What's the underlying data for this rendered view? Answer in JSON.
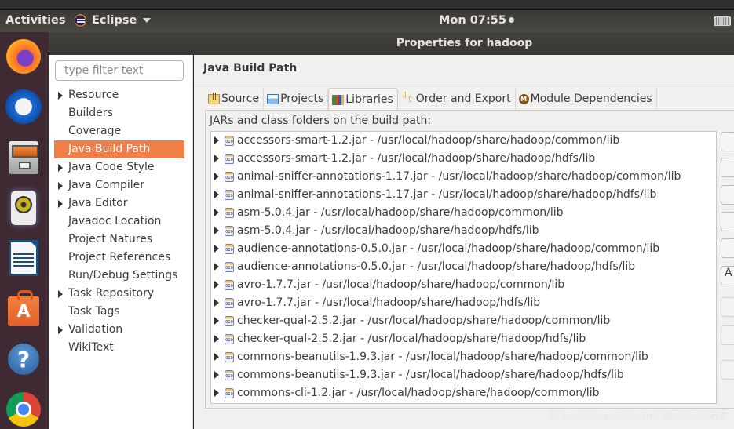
{
  "topbar": {
    "activities": "Activities",
    "app_name": "Eclipse",
    "clock": "Mon 07:55"
  },
  "dock": {
    "items": [
      {
        "name": "firefox-icon"
      },
      {
        "name": "thunderbird-icon"
      },
      {
        "name": "files-icon"
      },
      {
        "name": "rhythmbox-icon"
      },
      {
        "name": "libreoffice-writer-icon"
      },
      {
        "name": "ubuntu-software-icon"
      },
      {
        "name": "help-icon"
      },
      {
        "name": "chrome-icon"
      }
    ]
  },
  "dialog": {
    "title": "Properties for hadoop"
  },
  "nav": {
    "filter_placeholder": "type filter text",
    "items": [
      {
        "label": "Resource",
        "expandable": true
      },
      {
        "label": "Builders",
        "expandable": false
      },
      {
        "label": "Coverage",
        "expandable": false
      },
      {
        "label": "Java Build Path",
        "expandable": false,
        "selected": true
      },
      {
        "label": "Java Code Style",
        "expandable": true
      },
      {
        "label": "Java Compiler",
        "expandable": true
      },
      {
        "label": "Java Editor",
        "expandable": true
      },
      {
        "label": "Javadoc Location",
        "expandable": false
      },
      {
        "label": "Project Natures",
        "expandable": false
      },
      {
        "label": "Project References",
        "expandable": false
      },
      {
        "label": "Run/Debug Settings",
        "expandable": false
      },
      {
        "label": "Task Repository",
        "expandable": true
      },
      {
        "label": "Task Tags",
        "expandable": false
      },
      {
        "label": "Validation",
        "expandable": true
      },
      {
        "label": "WikiText",
        "expandable": false
      }
    ]
  },
  "page": {
    "title": "Java Build Path",
    "tabs": [
      {
        "label": "Source",
        "icon": "source-folder-icon"
      },
      {
        "label": "Projects",
        "icon": "projects-folder-icon"
      },
      {
        "label": "Libraries",
        "icon": "libraries-icon",
        "active": true
      },
      {
        "label": "Order and Export",
        "icon": "order-arrows-icon"
      },
      {
        "label": "Module Dependencies",
        "icon": "module-icon"
      }
    ],
    "list_label": "JARs and class folders on the build path:",
    "jars": [
      "accessors-smart-1.2.jar - /usr/local/hadoop/share/hadoop/common/lib",
      "accessors-smart-1.2.jar - /usr/local/hadoop/share/hadoop/hdfs/lib",
      "animal-sniffer-annotations-1.17.jar - /usr/local/hadoop/share/hadoop/common/lib",
      "animal-sniffer-annotations-1.17.jar - /usr/local/hadoop/share/hadoop/hdfs/lib",
      "asm-5.0.4.jar - /usr/local/hadoop/share/hadoop/common/lib",
      "asm-5.0.4.jar - /usr/local/hadoop/share/hadoop/hdfs/lib",
      "audience-annotations-0.5.0.jar - /usr/local/hadoop/share/hadoop/common/lib",
      "audience-annotations-0.5.0.jar - /usr/local/hadoop/share/hadoop/hdfs/lib",
      "avro-1.7.7.jar - /usr/local/hadoop/share/hadoop/common/lib",
      "avro-1.7.7.jar - /usr/local/hadoop/share/hadoop/hdfs/lib",
      "checker-qual-2.5.2.jar - /usr/local/hadoop/share/hadoop/common/lib",
      "checker-qual-2.5.2.jar - /usr/local/hadoop/share/hadoop/hdfs/lib",
      "commons-beanutils-1.9.3.jar - /usr/local/hadoop/share/hadoop/common/lib",
      "commons-beanutils-1.9.3.jar - /usr/local/hadoop/share/hadoop/hdfs/lib",
      "commons-cli-1.2.jar - /usr/local/hadoop/share/hadoop/common/lib"
    ],
    "side_buttons": [
      {
        "label": "",
        "enabled": true
      },
      {
        "label": "",
        "enabled": true
      },
      {
        "label": "",
        "enabled": true
      },
      {
        "label": "",
        "enabled": true
      },
      {
        "label": "",
        "enabled": true
      },
      {
        "label": "A",
        "enabled": true
      },
      {
        "label": "",
        "enabled": false
      },
      {
        "label": "",
        "enabled": false
      },
      {
        "label": "",
        "enabled": false
      }
    ]
  },
  "colors": {
    "selection": "#ef7e49",
    "dock_bg": "#3f2a33"
  },
  "watermark": "https://blog.csdn.net/@51CTO博客"
}
